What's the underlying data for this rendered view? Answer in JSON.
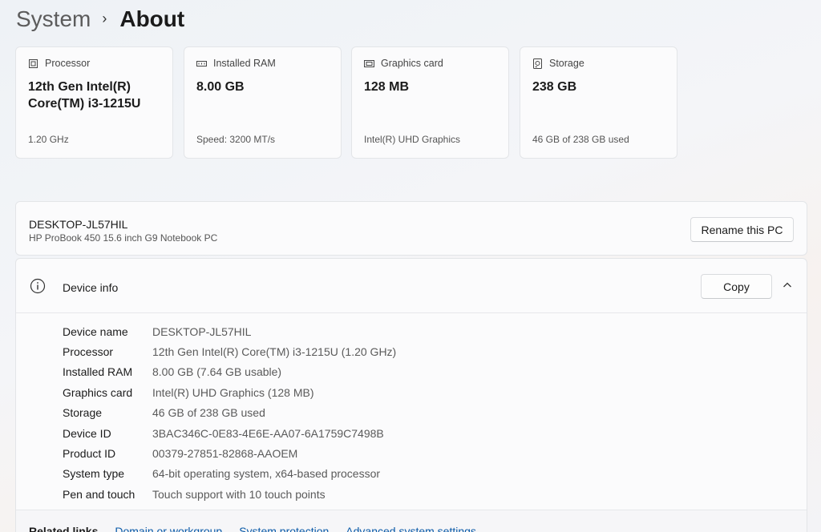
{
  "breadcrumb": {
    "parent": "System",
    "separator": "›",
    "current": "About"
  },
  "cards": [
    {
      "title": "Processor",
      "value": "12th Gen Intel(R) Core(TM) i3-1215U",
      "sub": "1.20 GHz",
      "icon": "processor-icon"
    },
    {
      "title": "Installed RAM",
      "value": "8.00 GB",
      "sub": "Speed: 3200 MT/s",
      "icon": "ram-icon"
    },
    {
      "title": "Graphics card",
      "value": "128 MB",
      "sub": "Intel(R) UHD Graphics",
      "icon": "graphics-card-icon"
    },
    {
      "title": "Storage",
      "value": "238 GB",
      "sub": "46 GB of 238 GB used",
      "icon": "storage-icon"
    }
  ],
  "pc": {
    "name": "DESKTOP-JL57HIL",
    "model": "HP ProBook 450 15.6 inch G9 Notebook PC",
    "rename_label": "Rename this PC"
  },
  "device_info": {
    "title": "Device info",
    "copy_label": "Copy",
    "rows": [
      {
        "label": "Device name",
        "value": "DESKTOP-JL57HIL"
      },
      {
        "label": "Processor",
        "value": "12th Gen Intel(R) Core(TM) i3-1215U (1.20 GHz)"
      },
      {
        "label": "Installed RAM",
        "value": "8.00 GB (7.64 GB usable)"
      },
      {
        "label": "Graphics card",
        "value": "Intel(R) UHD Graphics (128 MB)"
      },
      {
        "label": "Storage",
        "value": "46 GB of 238 GB used"
      },
      {
        "label": "Device ID",
        "value": "3BAC346C-0E83-4E6E-AA07-6A1759C7498B"
      },
      {
        "label": "Product ID",
        "value": "00379-27851-82868-AAOEM"
      },
      {
        "label": "System type",
        "value": "64-bit operating system, x64-based processor"
      },
      {
        "label": "Pen and touch",
        "value": "Touch support with 10 touch points"
      }
    ]
  },
  "related": {
    "label": "Related links",
    "links": [
      "Domain or workgroup",
      "System protection",
      "Advanced system settings"
    ]
  },
  "colors": {
    "link": "#0a5aa8",
    "card_bg": "#fbfbfc",
    "border": "#e3e5e8"
  }
}
